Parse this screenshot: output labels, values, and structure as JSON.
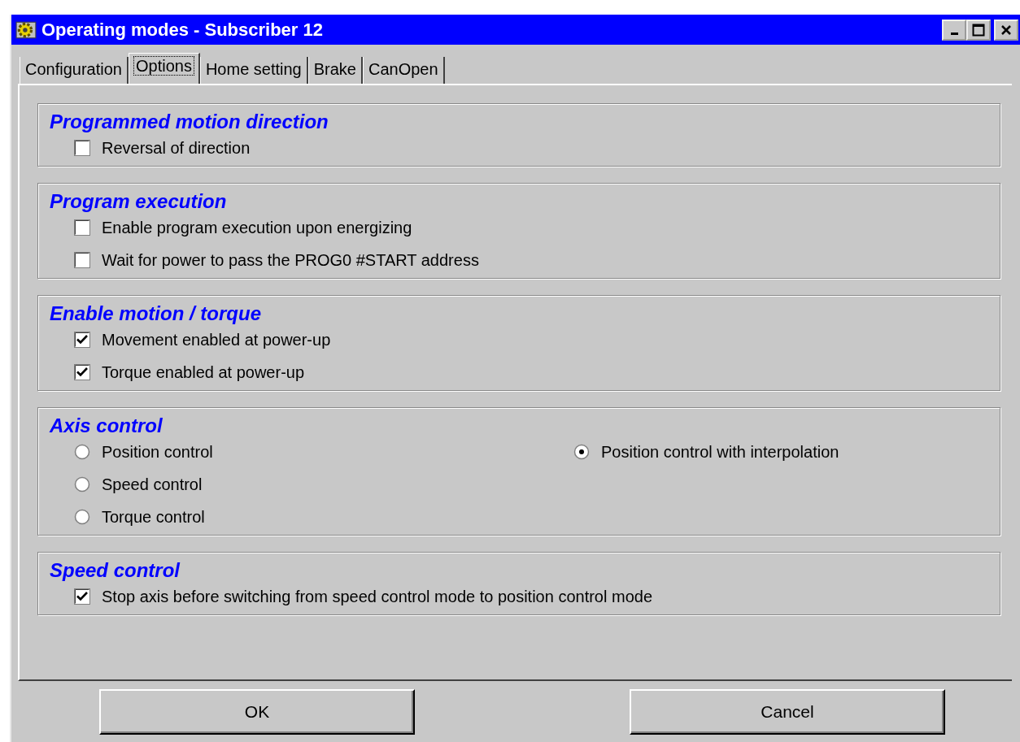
{
  "window": {
    "title": "Operating modes - Subscriber 12"
  },
  "tabs": [
    {
      "label": "Configuration",
      "selected": false
    },
    {
      "label": "Options",
      "selected": true
    },
    {
      "label": "Home setting",
      "selected": false
    },
    {
      "label": "Brake",
      "selected": false
    },
    {
      "label": "CanOpen",
      "selected": false
    }
  ],
  "groups": [
    {
      "title": "Programmed motion direction",
      "columns": [
        [
          {
            "kind": "checkbox",
            "label": "Reversal of direction",
            "checked": false
          }
        ]
      ]
    },
    {
      "title": "Program execution",
      "columns": [
        [
          {
            "kind": "checkbox",
            "label": "Enable program execution upon energizing",
            "checked": false
          },
          {
            "kind": "checkbox",
            "label": "Wait for power to pass the PROG0 #START address",
            "checked": false
          }
        ]
      ]
    },
    {
      "title": "Enable motion / torque",
      "columns": [
        [
          {
            "kind": "checkbox",
            "label": "Movement enabled at power-up",
            "checked": true
          },
          {
            "kind": "checkbox",
            "label": "Torque enabled at power-up",
            "checked": true
          }
        ]
      ]
    },
    {
      "title": "Axis control",
      "columns": [
        [
          {
            "kind": "radio",
            "label": "Position control",
            "selected": false
          },
          {
            "kind": "radio",
            "label": "Speed control",
            "selected": false
          },
          {
            "kind": "radio",
            "label": "Torque control",
            "selected": false
          }
        ],
        [
          {
            "kind": "radio",
            "label": "Position control with interpolation",
            "selected": true
          }
        ]
      ]
    },
    {
      "title": "Speed control",
      "columns": [
        [
          {
            "kind": "checkbox",
            "label": "Stop axis before switching from speed control mode to position control mode",
            "checked": true
          }
        ]
      ]
    }
  ],
  "buttons": [
    "OK",
    "Cancel"
  ]
}
